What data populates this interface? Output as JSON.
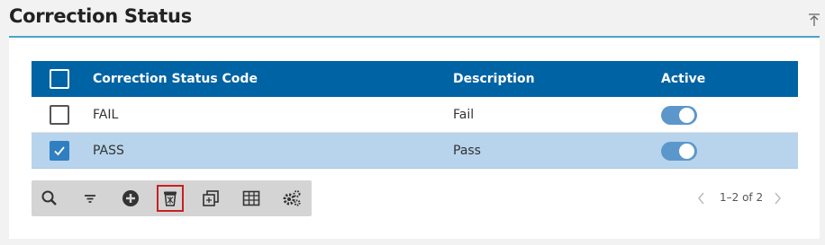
{
  "page": {
    "title": "Correction Status",
    "collapse_icon": "collapse-up-icon"
  },
  "grid": {
    "columns": [
      "Correction Status Code",
      "Description",
      "Active"
    ],
    "rows": [
      {
        "code": "FAIL",
        "description": "Fail",
        "active": true,
        "selected": false
      },
      {
        "code": "PASS",
        "description": "Pass",
        "active": true,
        "selected": true
      }
    ]
  },
  "toolbar": {
    "buttons": [
      "search-icon",
      "filter-icon",
      "add-icon",
      "delete-icon",
      "copy-icon",
      "grid-layout-icon",
      "settings-icon"
    ],
    "active_button": "delete-icon"
  },
  "pager": {
    "label": "1–2 of 2"
  },
  "colors": {
    "header": "#0063a3",
    "selected_row": "#b7d4ec",
    "toggle_on": "#5c97cc",
    "title_rule": "#4aa3c8",
    "active_outline": "#c82020"
  }
}
